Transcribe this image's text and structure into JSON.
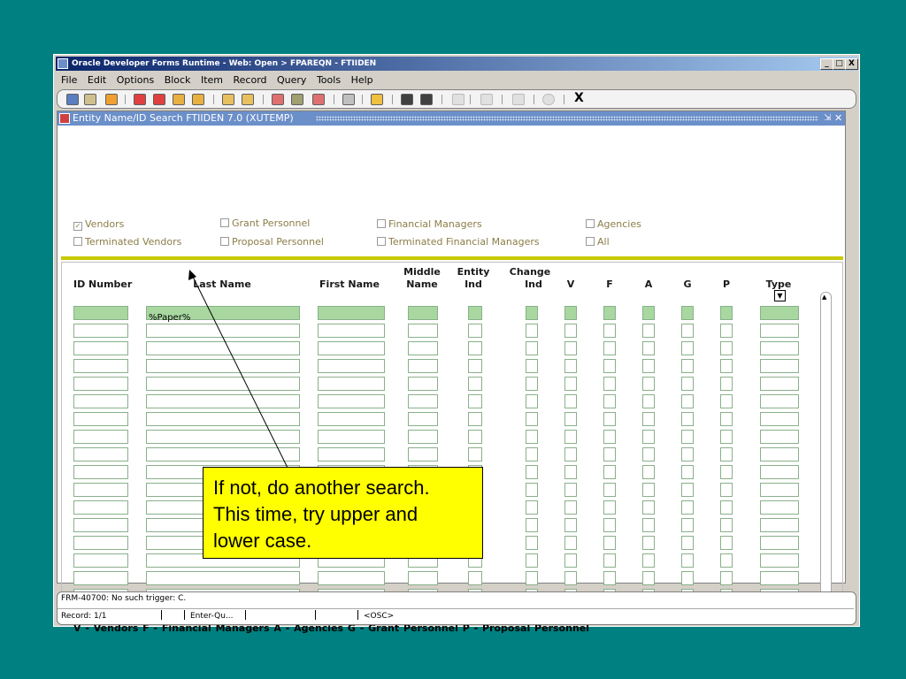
{
  "window": {
    "title": "Oracle Developer Forms Runtime - Web:  Open > FPAREQN - FTIIDEN",
    "btn_min": "_",
    "btn_max": "□",
    "btn_close": "X"
  },
  "menu": [
    "File",
    "Edit",
    "Options",
    "Block",
    "Item",
    "Record",
    "Query",
    "Tools",
    "Help"
  ],
  "toolbar": {
    "exit_label": "X"
  },
  "form": {
    "title": "Entity Name/ID Search  FTIIDEN  7.0  (XUTEMP)",
    "checkboxes": [
      {
        "label": "Vendors",
        "checked": true
      },
      {
        "label": "Terminated Vendors",
        "checked": false
      },
      {
        "label": "Grant Personnel",
        "checked": false
      },
      {
        "label": "Proposal Personnel",
        "checked": false
      },
      {
        "label": "Financial Managers",
        "checked": false
      },
      {
        "label": "Terminated Financial Managers",
        "checked": false
      },
      {
        "label": "Agencies",
        "checked": false
      },
      {
        "label": "All",
        "checked": false
      }
    ],
    "columns": {
      "id": "ID Number",
      "last": "Last Name",
      "first": "First Name",
      "middle_1": "Middle",
      "middle_2": "Name",
      "entity_1": "Entity",
      "entity_2": "Ind",
      "change_1": "Change",
      "change_2": "Ind",
      "v": "V",
      "f": "F",
      "a": "A",
      "g": "G",
      "p": "P",
      "type": "Type"
    },
    "query_last_name": "%Paper%",
    "legend": "V - Vendors   F - Financial Managers   A - Agencies   G - Grant Personnel   P - Proposal Personnel"
  },
  "status": {
    "message": "FRM-40700: No such trigger:  C.",
    "record": "Record: 1/1",
    "mode": "Enter-Qu...",
    "osc": "<OSC>"
  },
  "callout": {
    "line1": "If not, do another search.",
    "line2": "This time, try upper and",
    "line3": "lower case."
  },
  "colors": {
    "desktop": "#008080",
    "callout": "#ffff00",
    "current_row": "#a8d8a0",
    "accent_bar": "#c8c800"
  }
}
